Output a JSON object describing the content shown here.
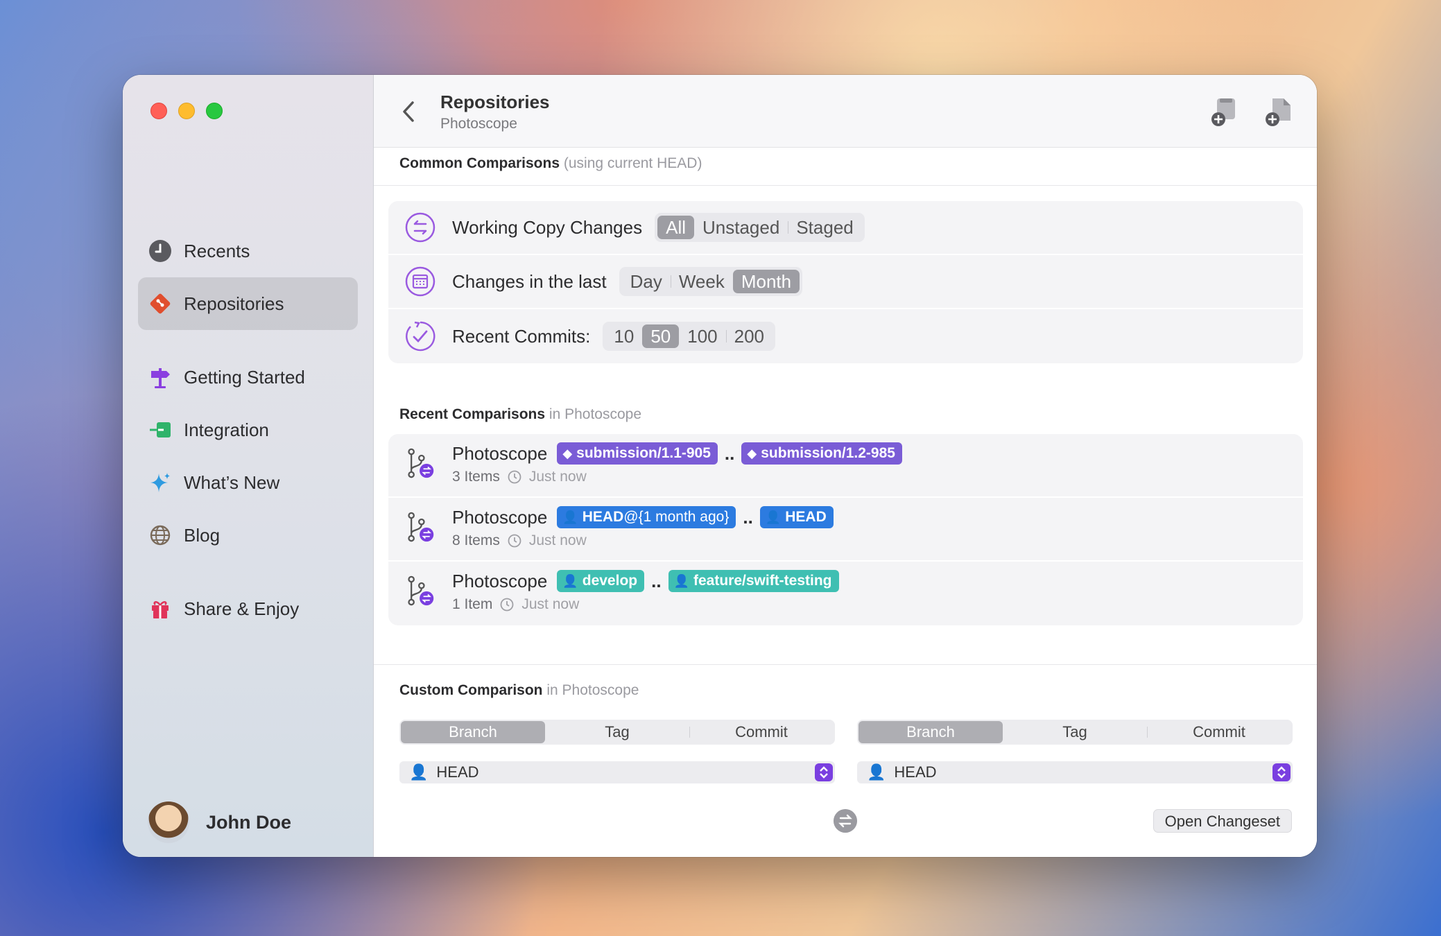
{
  "sidebar": {
    "items": [
      {
        "label": "Recents",
        "icon": "clock-icon"
      },
      {
        "label": "Repositories",
        "icon": "git-icon"
      },
      {
        "label": "Getting Started",
        "icon": "signpost-icon"
      },
      {
        "label": "Integration",
        "icon": "integration-icon"
      },
      {
        "label": "What’s New",
        "icon": "sparkles-icon"
      },
      {
        "label": "Blog",
        "icon": "globe-icon"
      },
      {
        "label": "Share & Enjoy",
        "icon": "gift-icon"
      }
    ],
    "user": {
      "name": "John Doe"
    }
  },
  "header": {
    "title": "Repositories",
    "subtitle": "Photoscope"
  },
  "common": {
    "title": "Common Comparisons",
    "note": "(using current HEAD)",
    "working_copy": {
      "label": "Working Copy Changes",
      "options": [
        "All",
        "Unstaged",
        "Staged"
      ],
      "selected": "All"
    },
    "changes_last": {
      "label": "Changes in the last",
      "options": [
        "Day",
        "Week",
        "Month"
      ],
      "selected": "Month"
    },
    "recent_commits": {
      "label": "Recent Commits:",
      "options": [
        "10",
        "50",
        "100",
        "200"
      ],
      "selected": "50"
    }
  },
  "recent": {
    "title": "Recent Comparisons",
    "context": "in Photoscope",
    "rows": [
      {
        "name": "Photoscope",
        "from": "submission/1.1-905",
        "to": "submission/1.2-985",
        "count": "3 Items",
        "when": "Just now"
      },
      {
        "name": "Photoscope",
        "from": "HEAD",
        "from_extra": "@{1 month ago}",
        "to": "HEAD",
        "count": "8 Items",
        "when": "Just now"
      },
      {
        "name": "Photoscope",
        "from": "develop",
        "to": "feature/swift-testing",
        "count": "1 Item",
        "when": "Just now"
      }
    ],
    "separator": ".."
  },
  "custom": {
    "title": "Custom Comparison",
    "context": "in Photoscope",
    "left": {
      "options": [
        "Branch",
        "Tag",
        "Commit"
      ],
      "selected": "Branch",
      "value": "HEAD"
    },
    "right": {
      "options": [
        "Branch",
        "Tag",
        "Commit"
      ],
      "selected": "Branch",
      "value": "HEAD"
    },
    "open_button": "Open Changeset"
  },
  "colors": {
    "tag_purple": "#7a5cd6",
    "branch_blue": "#2c7be0",
    "branch_teal": "#3fbfb2",
    "accent": "#7a3fe0"
  }
}
